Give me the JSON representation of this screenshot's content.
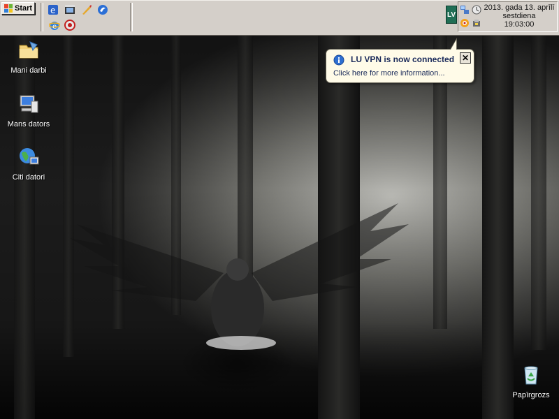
{
  "taskbar": {
    "start_label": "Start",
    "quick_launch": [
      "browser-e-icon",
      "media-player-icon",
      "paint-icon",
      "messenger-icon",
      "ie-icon",
      "opera-icon"
    ]
  },
  "tray": {
    "lv_label": "LV",
    "icons": [
      "network-icon",
      "clock-sync-icon",
      "opera-tray-icon",
      "security-tray-icon"
    ],
    "clock": {
      "date": "2013. gada 13. aprīlī",
      "weekday": "sestdiena",
      "time": "19:03:00"
    }
  },
  "balloon": {
    "title": "LU VPN is now connected",
    "message": "Click here for more information...",
    "close_label": "✕"
  },
  "desktop": {
    "icons": [
      {
        "label": "Mani darbi"
      },
      {
        "label": "Mans dators"
      },
      {
        "label": "Citi datori"
      },
      {
        "label": "Papīrgrozs"
      }
    ]
  },
  "colors": {
    "taskbar_bg": "#d4cfc9",
    "balloon_bg": "#fffbe8",
    "lv_bg": "#1f6e55"
  }
}
